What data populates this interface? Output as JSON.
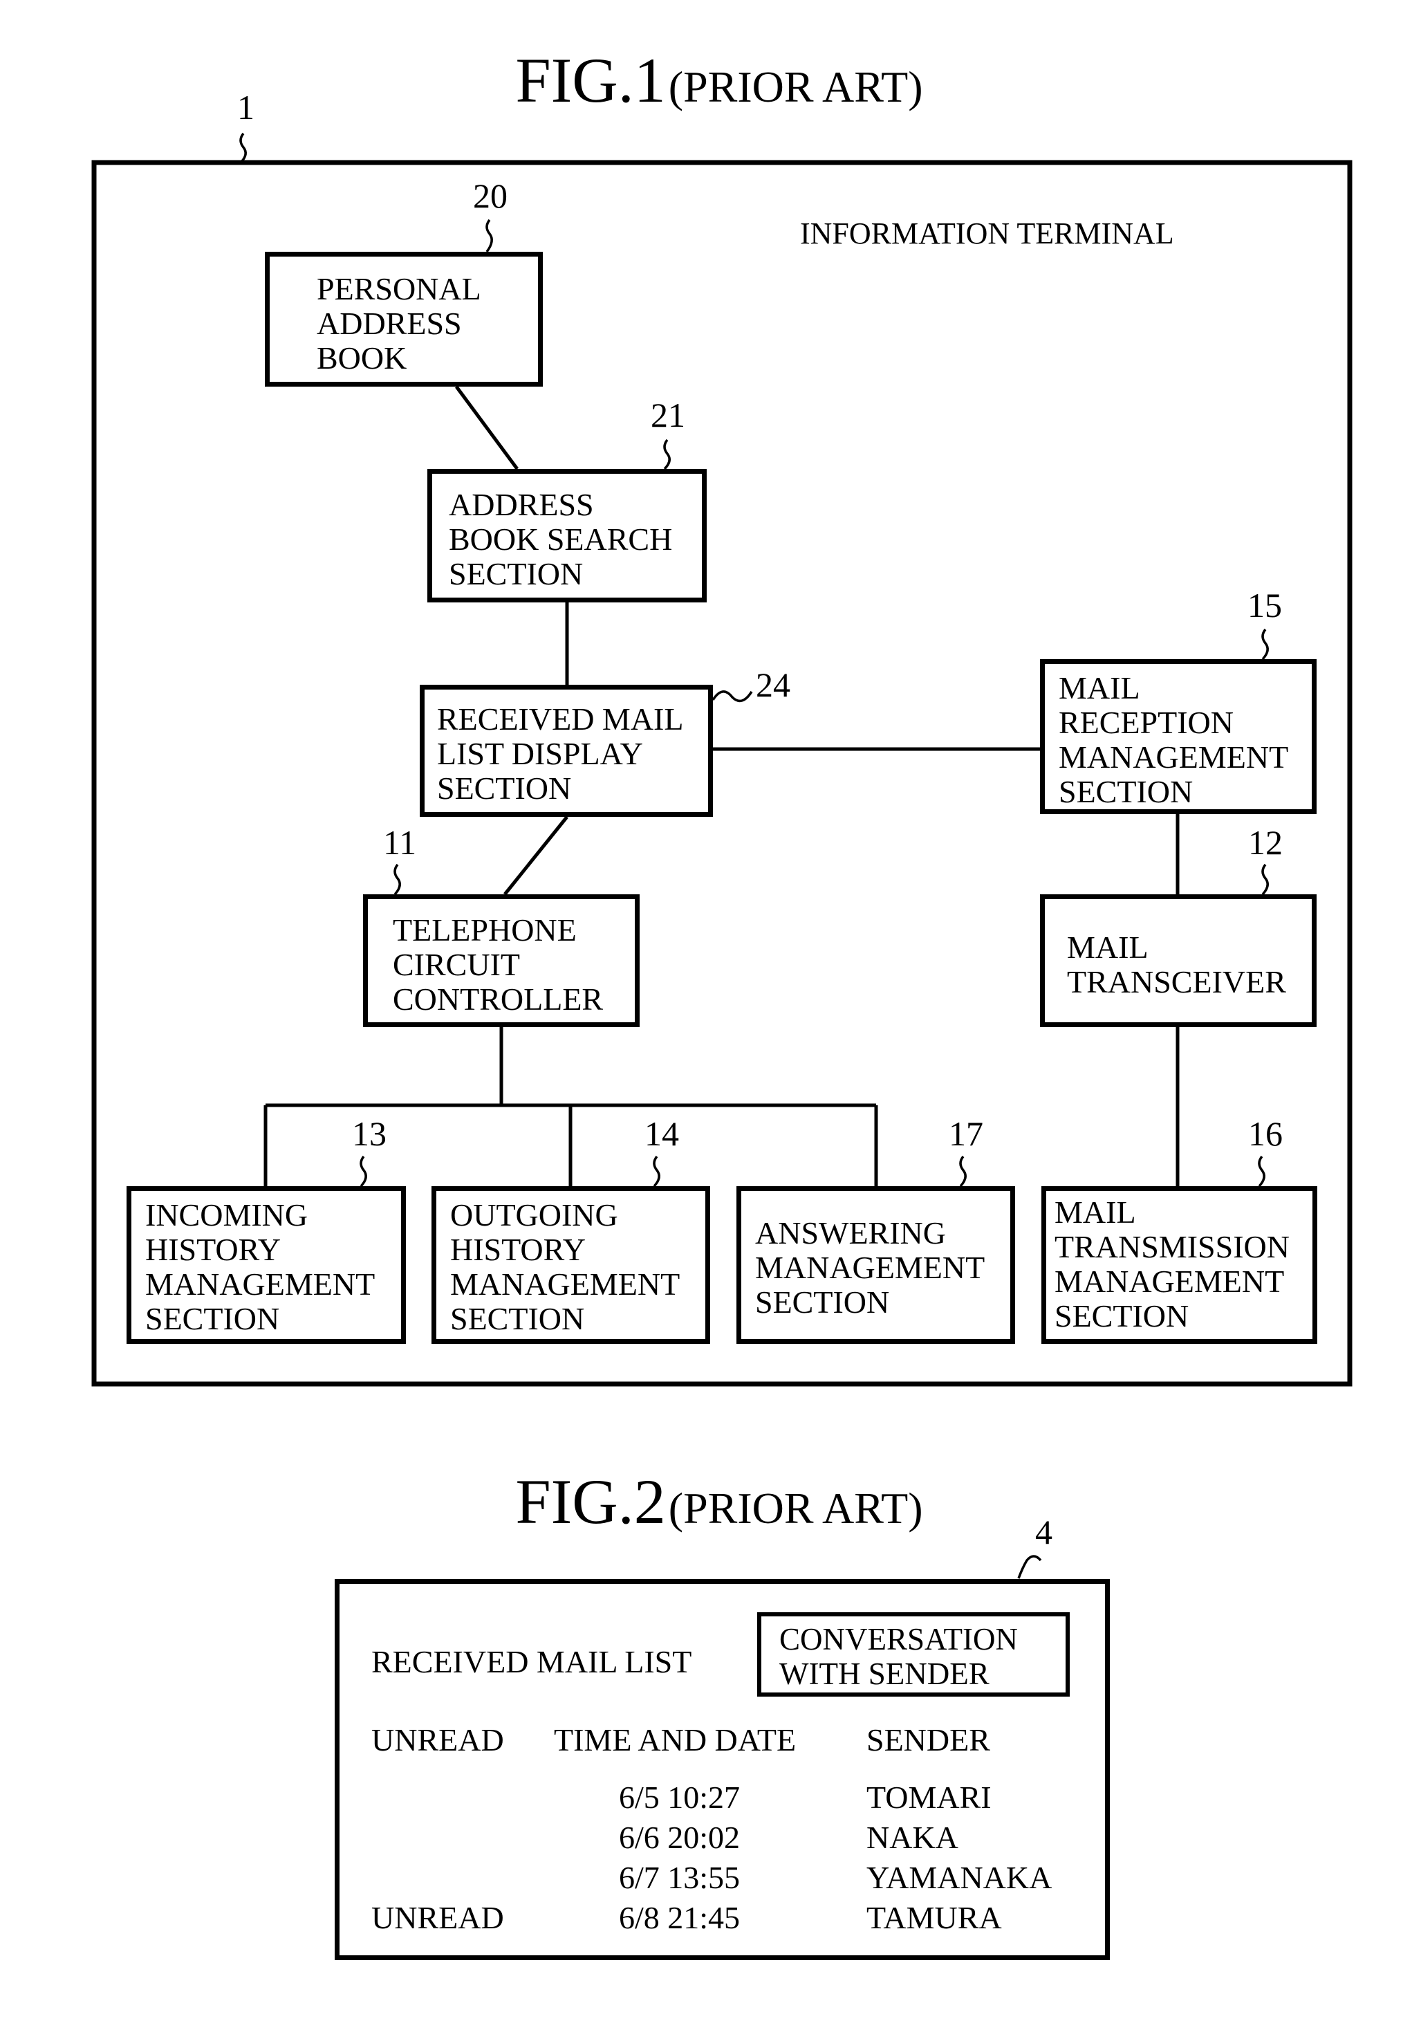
{
  "fig1": {
    "title": "FIG.1",
    "subtitle": "(PRIOR ART)",
    "container": {
      "ref": "1",
      "label": "INFORMATION TERMINAL"
    },
    "blocks": {
      "personal_address_book": {
        "ref": "20",
        "label": "PERSONAL\nADDRESS\nBOOK"
      },
      "address_book_search": {
        "ref": "21",
        "label": "ADDRESS\nBOOK SEARCH\nSECTION"
      },
      "received_mail_list_display": {
        "ref": "24",
        "label": "RECEIVED MAIL\nLIST DISPLAY\nSECTION"
      },
      "mail_reception_management": {
        "ref": "15",
        "label": "MAIL\nRECEPTION\nMANAGEMENT\nSECTION"
      },
      "telephone_circuit_controller": {
        "ref": "11",
        "label": "TELEPHONE\nCIRCUIT\nCONTROLLER"
      },
      "mail_transceiver": {
        "ref": "12",
        "label": "MAIL\nTRANSCEIVER"
      },
      "incoming_history_management": {
        "ref": "13",
        "label": "INCOMING\nHISTORY\nMANAGEMENT\nSECTION"
      },
      "outgoing_history_management": {
        "ref": "14",
        "label": "OUTGOING\nHISTORY\nMANAGEMENT\nSECTION"
      },
      "answering_management": {
        "ref": "17",
        "label": "ANSWERING\nMANAGEMENT\nSECTION"
      },
      "mail_transmission_management": {
        "ref": "16",
        "label": "MAIL\nTRANSMISSION\nMANAGEMENT\nSECTION"
      }
    },
    "connections": [
      [
        "personal_address_book",
        "address_book_search"
      ],
      [
        "address_book_search",
        "received_mail_list_display"
      ],
      [
        "received_mail_list_display",
        "mail_reception_management"
      ],
      [
        "received_mail_list_display",
        "telephone_circuit_controller"
      ],
      [
        "mail_reception_management",
        "mail_transceiver"
      ],
      [
        "mail_transceiver",
        "mail_transmission_management"
      ],
      [
        "telephone_circuit_controller",
        "incoming_history_management"
      ],
      [
        "telephone_circuit_controller",
        "outgoing_history_management"
      ],
      [
        "telephone_circuit_controller",
        "answering_management"
      ]
    ]
  },
  "fig2": {
    "title": "FIG.2",
    "subtitle": "(PRIOR ART)",
    "screen_ref": "4",
    "list_title": "RECEIVED MAIL LIST",
    "conversation_button": "CONVERSATION\nWITH SENDER",
    "columns": [
      "UNREAD",
      "TIME AND DATE",
      "SENDER"
    ],
    "rows": [
      {
        "unread": "",
        "datetime": "6/5 10:27",
        "sender": "TOMARI"
      },
      {
        "unread": "",
        "datetime": "6/6 20:02",
        "sender": "NAKA"
      },
      {
        "unread": "",
        "datetime": "6/7 13:55",
        "sender": "YAMANAKA"
      },
      {
        "unread": "UNREAD",
        "datetime": "6/8 21:45",
        "sender": "TAMURA"
      }
    ]
  }
}
